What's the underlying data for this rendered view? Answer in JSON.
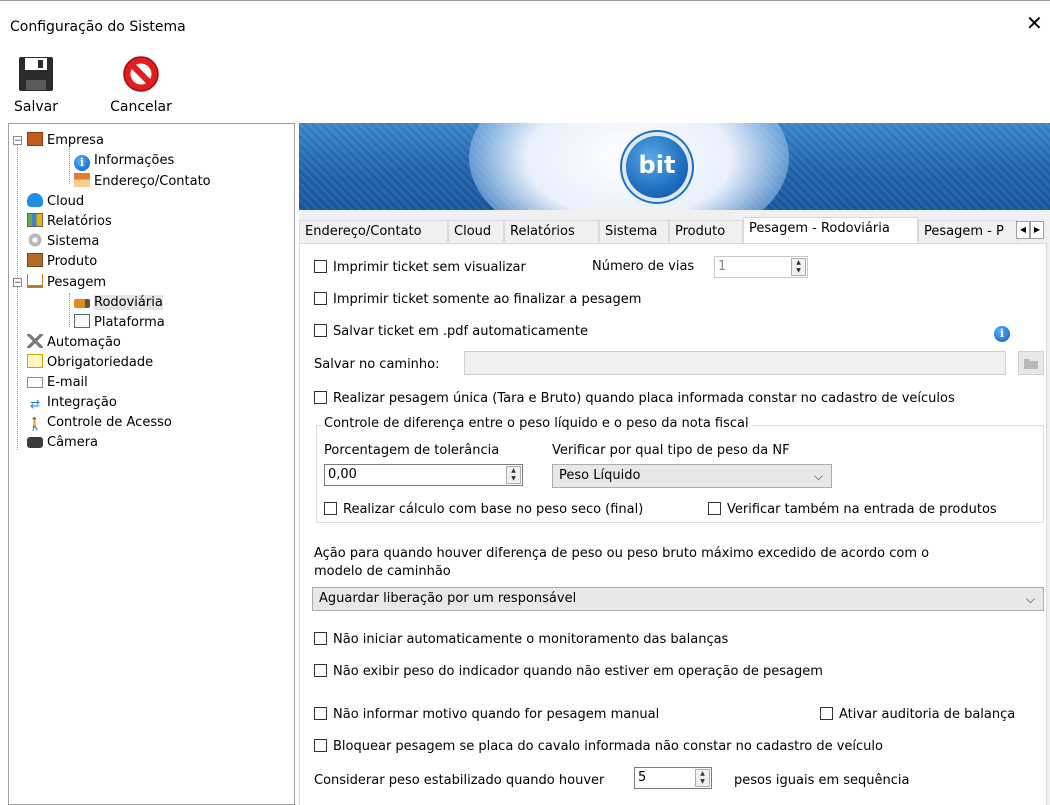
{
  "window": {
    "title": "Configuração do Sistema",
    "close_glyph": "✕"
  },
  "toolbar": {
    "save_label": "Salvar",
    "cancel_label": "Cancelar"
  },
  "tree": {
    "empresa": "Empresa",
    "informacoes": "Informações",
    "endereco": "Endereço/Contato",
    "cloud": "Cloud",
    "relatorios": "Relatórios",
    "sistema": "Sistema",
    "produto": "Produto",
    "pesagem": "Pesagem",
    "rodoviaria": "Rodoviária",
    "plataforma": "Plataforma",
    "automacao": "Automação",
    "obrigatoriedade": "Obrigatoriedade",
    "email": "E-mail",
    "integracao": "Integração",
    "controle_acesso": "Controle de Acesso",
    "camera": "Câmera"
  },
  "banner": {
    "logo_text": "bit"
  },
  "tabs": [
    "Endereço/Contato",
    "Cloud",
    "Relatórios",
    "Sistema",
    "Produto",
    "Pesagem - Rodoviária",
    "Pesagem - P"
  ],
  "active_tab": "Pesagem - Rodoviária",
  "form": {
    "imprimir_sem_visualizar": "Imprimir ticket sem visualizar",
    "numero_vias_label": "Número de vias",
    "numero_vias_value": "1",
    "imprimir_ao_finalizar": "Imprimir ticket somente ao finalizar a pesagem",
    "salvar_pdf": "Salvar ticket em .pdf automaticamente",
    "salvar_caminho_label": "Salvar no caminho:",
    "salvar_caminho_value": "",
    "pesagem_unica": "Realizar pesagem única (Tara e Bruto) quando placa informada constar no cadastro de veículos",
    "grupo_titulo": "Controle de diferença entre o peso líquido e o peso da nota fiscal",
    "porcentagem_label": "Porcentagem de tolerância",
    "porcentagem_value": "0,00",
    "tipo_peso_label": "Verificar por qual tipo de peso da NF",
    "tipo_peso_value": "Peso Líquido",
    "calculo_peso_seco": "Realizar cálculo com base no peso seco (final)",
    "verificar_entrada": "Verificar também na entrada de produtos",
    "acao_label_1": "Ação para quando houver diferença de peso ou peso bruto máximo excedido de acordo com o",
    "acao_label_2": "modelo de caminhão",
    "acao_value": "Aguardar liberação por um responsável",
    "nao_iniciar_monitoramento": "Não iniciar automaticamente o monitoramento das balanças",
    "nao_exibir_peso": "Não exibir peso do indicador quando não estiver em operação de pesagem",
    "nao_informar_motivo": "Não informar motivo quando for pesagem manual",
    "ativar_auditoria": "Ativar auditoria de balança",
    "bloquear_pesagem": "Bloquear pesagem se placa do cavalo informada não constar no cadastro de veículo",
    "considerar_label": "Considerar peso estabilizado quando houver",
    "considerar_value": "5",
    "pesos_iguais_label": "pesos iguais em sequência"
  }
}
